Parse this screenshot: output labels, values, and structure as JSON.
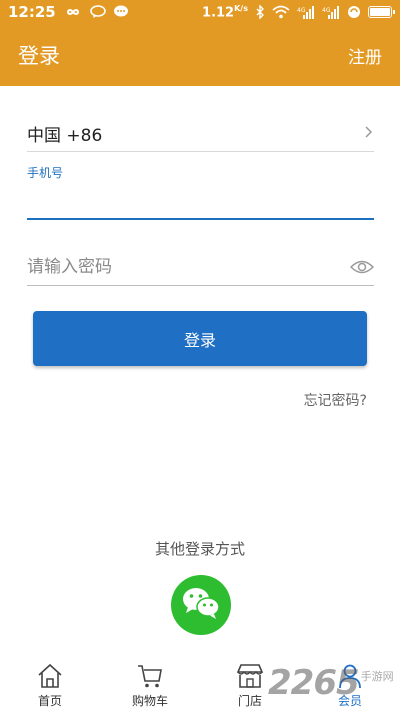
{
  "status_bar": {
    "time": "12:25",
    "speed": "1.12",
    "speed_unit": "K/s",
    "signal_1": "4G",
    "signal_2": "4G"
  },
  "app_bar": {
    "title": "登录",
    "action": "注册"
  },
  "form": {
    "country_value": "中国 +86",
    "phone_label": "手机号",
    "phone_value": "",
    "password_placeholder": "请输入密码",
    "login_button": "登录",
    "forgot_link": "忘记密码?"
  },
  "other_login": {
    "label": "其他登录方式",
    "icons": [
      "wechat-icon"
    ]
  },
  "tab_bar": {
    "items": [
      {
        "label": "首页",
        "icon": "home-icon"
      },
      {
        "label": "购物车",
        "icon": "cart-icon"
      },
      {
        "label": "门店",
        "icon": "store-icon"
      },
      {
        "label": "会员",
        "icon": "member-icon",
        "active": true
      }
    ]
  },
  "watermark": {
    "number": "2265",
    "text": "手游网"
  },
  "colors": {
    "brand": "#e39a24",
    "primary": "#1f6fc5",
    "wechat": "#2ebd30"
  },
  "battery_level": 0.9
}
